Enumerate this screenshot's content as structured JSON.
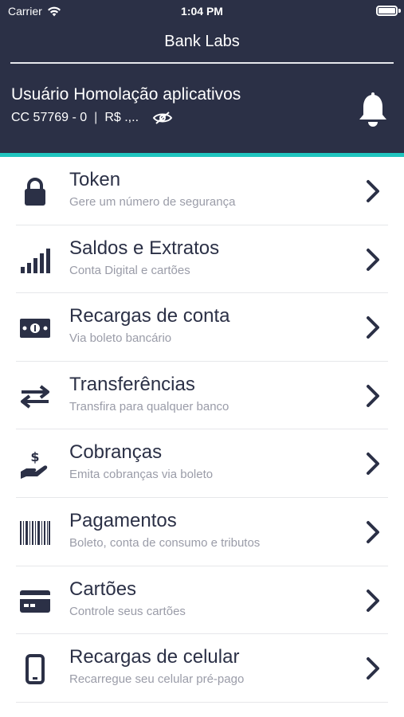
{
  "status_bar": {
    "carrier": "Carrier",
    "time": "1:04 PM"
  },
  "app_title": "Bank Labs",
  "user": {
    "name": "Usuário Homolação aplicativos",
    "account": "CC 57769 - 0",
    "separator": "|",
    "balance": "R$ .,.."
  },
  "colors": {
    "header_bg": "#2b3046",
    "accent": "#20c5bf",
    "subtitle": "#9a9ca8"
  },
  "menu": [
    {
      "icon": "lock-icon",
      "title": "Token",
      "subtitle": "Gere um número de segurança"
    },
    {
      "icon": "signal-bars-icon",
      "title": "Saldos e Extratos",
      "subtitle": "Conta Digital e cartões"
    },
    {
      "icon": "money-bill-icon",
      "title": "Recargas de conta",
      "subtitle": "Via boleto bancário"
    },
    {
      "icon": "transfer-arrows-icon",
      "title": "Transferências",
      "subtitle": "Transfira para qualquer banco"
    },
    {
      "icon": "hand-dollar-icon",
      "title": "Cobranças",
      "subtitle": "Emita cobranças via boleto"
    },
    {
      "icon": "barcode-icon",
      "title": "Pagamentos",
      "subtitle": "Boleto, conta de consumo e tributos"
    },
    {
      "icon": "credit-card-icon",
      "title": "Cartões",
      "subtitle": "Controle seus cartões"
    },
    {
      "icon": "mobile-phone-icon",
      "title": "Recargas de celular",
      "subtitle": "Recarregue seu celular pré-pago"
    }
  ]
}
